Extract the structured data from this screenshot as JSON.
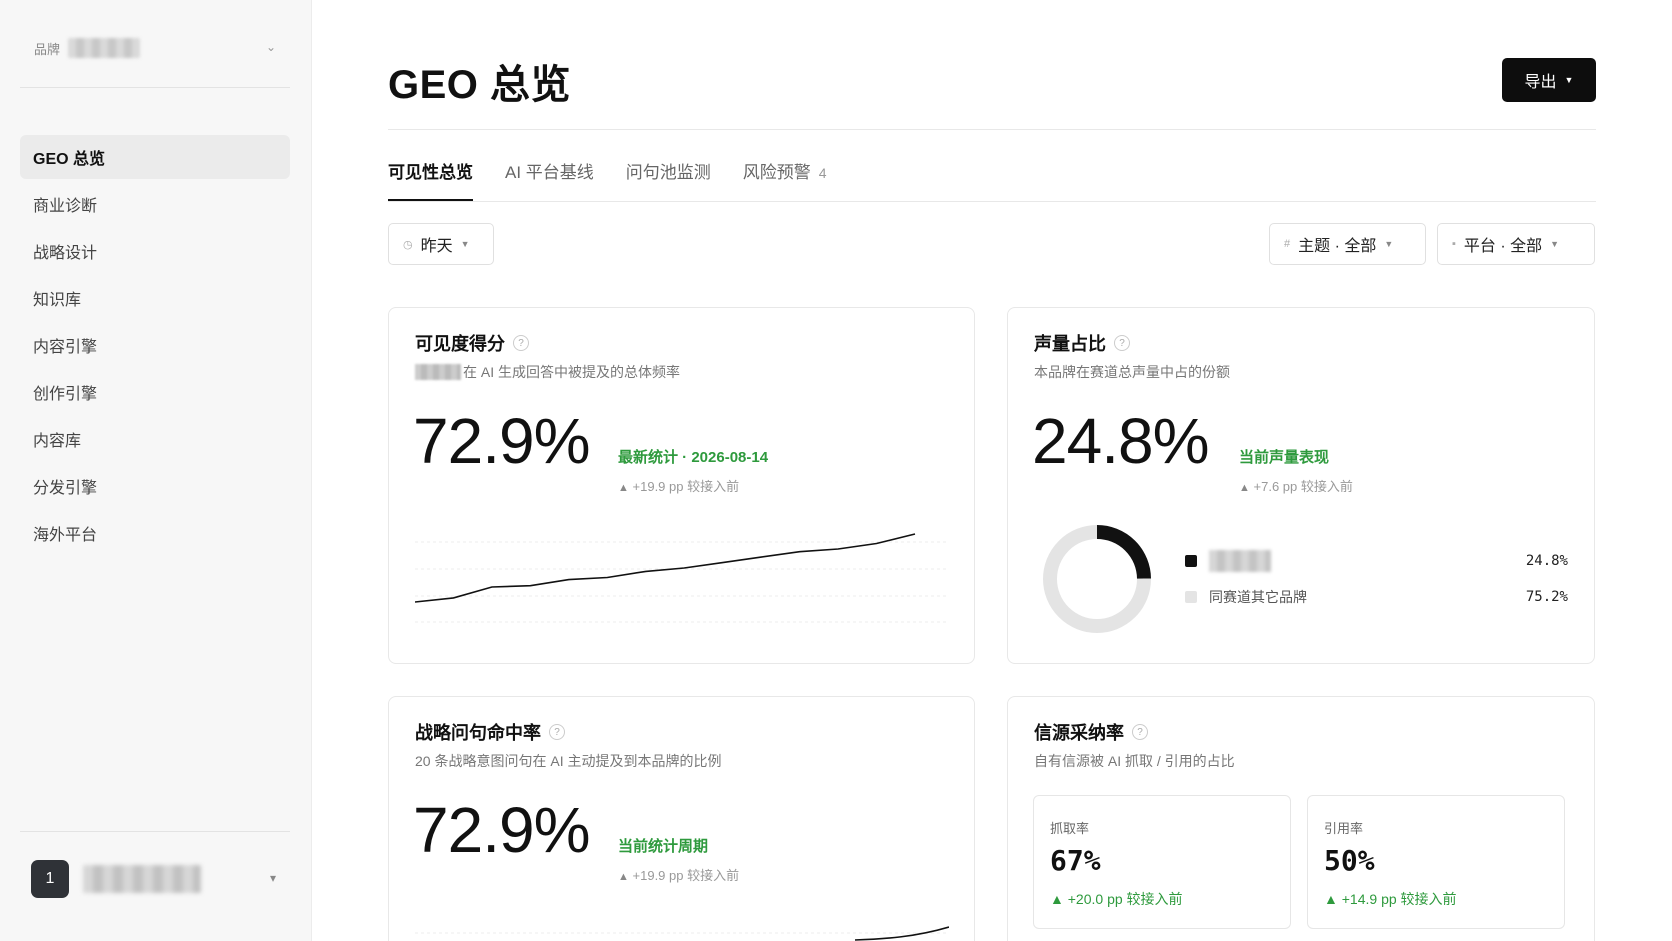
{
  "sidebar": {
    "brand_label": "品牌",
    "items": [
      {
        "label": "GEO 总览",
        "active": true
      },
      {
        "label": "商业诊断"
      },
      {
        "label": "战略设计"
      },
      {
        "label": "知识库"
      },
      {
        "label": "内容引擎"
      },
      {
        "label": "创作引擎"
      },
      {
        "label": "内容库"
      },
      {
        "label": "分发引擎"
      },
      {
        "label": "海外平台"
      }
    ],
    "user_avatar": "1"
  },
  "header": {
    "title": "GEO 总览",
    "export_label": "导出"
  },
  "tabs": [
    {
      "label": "可见性总览",
      "active": true
    },
    {
      "label": "AI 平台基线"
    },
    {
      "label": "问句池监测"
    },
    {
      "label": "风险预警",
      "badge": "4"
    }
  ],
  "filters": {
    "date": "昨天",
    "topic": "主题 · 全部",
    "platform": "平台 · 全部"
  },
  "visibility": {
    "title": "可见度得分",
    "subtitle": "在 AI 生成回答中被提及的总体频率",
    "value": "72.9%",
    "note": "最新统计 · 2026-08-14",
    "delta": "+19.9 pp 较接入前"
  },
  "share": {
    "title": "声量占比",
    "subtitle": "本品牌在赛道总声量中占的份额",
    "value": "24.8%",
    "note": "当前声量表现",
    "delta": "+7.6 pp 较接入前",
    "legend": [
      {
        "label": "",
        "value": "24.8%"
      },
      {
        "label": "同赛道其它品牌",
        "value": "75.2%"
      }
    ]
  },
  "strategy": {
    "title": "战略问句命中率",
    "subtitle": "20 条战略意图问句在 AI 主动提及到本品牌的比例",
    "value": "72.9%",
    "note": "当前统计周期",
    "delta": "+19.9 pp 较接入前"
  },
  "source": {
    "title": "信源采纳率",
    "subtitle": "自有信源被 AI 抓取 / 引用的占比",
    "crawl": {
      "label": "抓取率",
      "value": "67%",
      "delta": "+20.0 pp 较接入前"
    },
    "cite": {
      "label": "引用率",
      "value": "50%",
      "delta": "+14.9 pp 较接入前"
    }
  },
  "chart_data": [
    {
      "type": "line",
      "series": [
        {
          "values": [
            0.0,
            0.06,
            0.22,
            0.24,
            0.33,
            0.36,
            0.45,
            0.5,
            0.58,
            0.66,
            0.74,
            0.78,
            0.86,
            1.0
          ]
        }
      ]
    },
    {
      "type": "pie",
      "values": [
        24.8,
        75.2
      ],
      "colors": [
        "#111111",
        "#e4e4e4"
      ]
    }
  ]
}
